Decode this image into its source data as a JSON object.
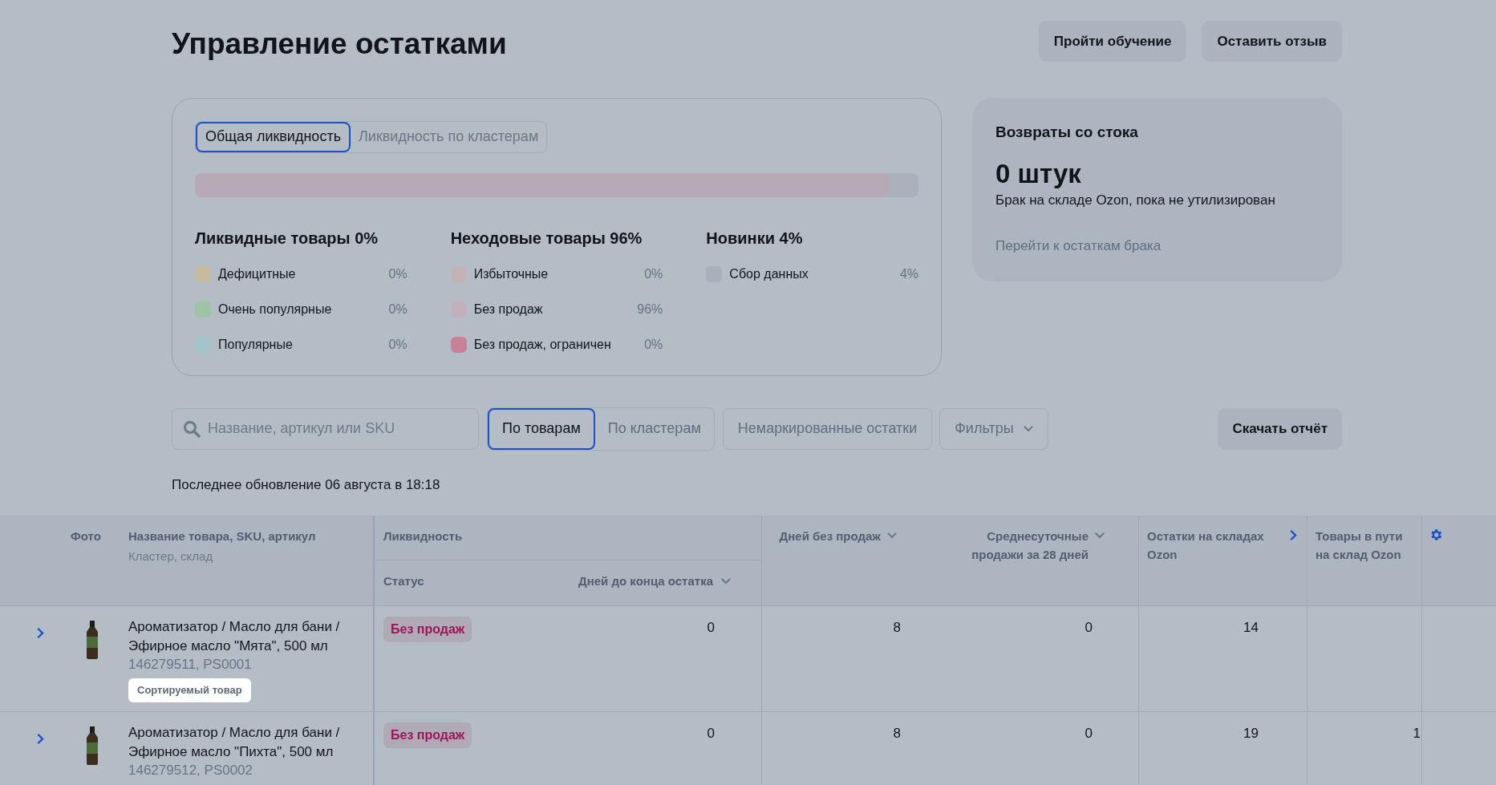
{
  "page": {
    "title": "Управление остатками",
    "actions": [
      "Пройти обучение",
      "Оставить отзыв"
    ]
  },
  "liquidity": {
    "tabs": [
      {
        "label": "Общая ликвидность",
        "selected": true
      },
      {
        "label": "Ликвидность по кластерам",
        "selected": false
      }
    ],
    "bar": {
      "level": 0.96
    },
    "groups": [
      {
        "title": "Ликвидные товары 0%",
        "items": [
          {
            "label": "Дефицитные",
            "value": "0%",
            "color": "#c8baa0"
          },
          {
            "label": "Очень популярные",
            "value": "0%",
            "color": "#9fc3a6"
          },
          {
            "label": "Популярные",
            "value": "0%",
            "color": "#a2c4ca"
          }
        ]
      },
      {
        "title": "Неходовые товары 96%",
        "items": [
          {
            "label": "Избыточные",
            "value": "0%",
            "color": "#c4b2b4"
          },
          {
            "label": "Без продаж",
            "value": "96%",
            "color": "#c2b0bd"
          },
          {
            "label": "Без продаж, ограничен",
            "value": "0%",
            "color": "#c98197"
          }
        ]
      },
      {
        "title": "Новинки 4%",
        "items": [
          {
            "label": "Сбор данных",
            "value": "4%",
            "color": "#a7b0bb"
          }
        ]
      }
    ]
  },
  "returns": {
    "title": "Возвраты со стока",
    "count": "0 штук",
    "description": "Брак на складе Ozon, пока не утилизирован",
    "link": "Перейти к остаткам брака"
  },
  "toolbar": {
    "search": {
      "placeholder": "Название, артикул или SKU"
    },
    "views": [
      {
        "label": "По товарам",
        "selected": true
      },
      {
        "label": "По кластерам",
        "selected": false
      }
    ],
    "unmarked": "Немаркированные остатки",
    "filters": "Фильтры",
    "download": "Скачать отчёт"
  },
  "last_update": "Последнее обновление 06 августа в 18:18",
  "table": {
    "photo": "Фото",
    "name": {
      "label": "Название товара, SKU, артикул",
      "sublabel": "Кластер, склад"
    },
    "liquidity": {
      "label": "Ликвидность",
      "status": "Статус",
      "days_to_end": {
        "label": "Дней до конца остатка",
        "kind": "sort"
      }
    },
    "columns": [
      {
        "label": "Дней без продаж",
        "kind": "sort"
      },
      {
        "label": "Среднесуточные продажи за 28 дней",
        "kind": "sort"
      },
      {
        "label": "Остатки на складах Ozon",
        "kind": "expand"
      },
      {
        "label": "Товары в пути на склад Ozon",
        "kind": "plain"
      }
    ],
    "rows": [
      {
        "expanded": false,
        "name": "Ароматизатор / Масло для бани / Эфирное масло \"Мята\", 500 мл",
        "ids": "146279511, PS0001",
        "tag": "Сортируемый товар",
        "status": "Без продаж",
        "days_to_end": "0",
        "days_without_sales": "8",
        "avg_daily_sales": "0",
        "stock": "14"
      },
      {
        "expanded": false,
        "name": "Ароматизатор / Масло для бани / Эфирное масло \"Пихта\", 500 мл",
        "ids": "146279512, PS0002",
        "status": "Без продаж",
        "days_to_end": "0",
        "days_without_sales": "8",
        "avg_daily_sales": "0",
        "stock": "19",
        "in_transit": "1"
      }
    ]
  }
}
